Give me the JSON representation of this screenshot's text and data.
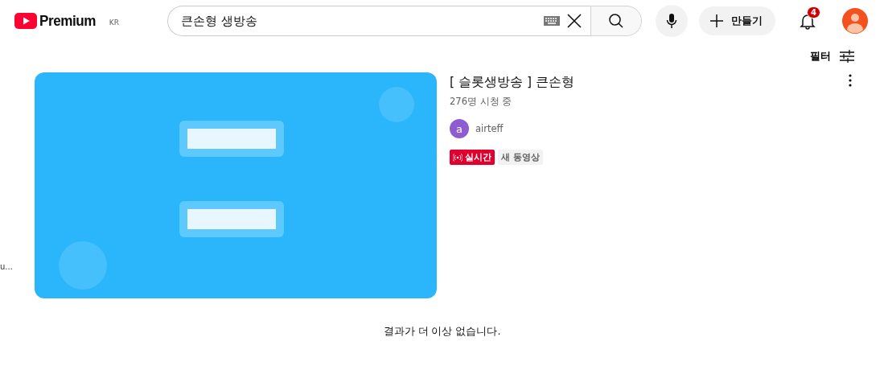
{
  "header": {
    "logo": {
      "text": "Premium",
      "region": "KR"
    },
    "search": {
      "value": "큰손형 생방송"
    },
    "create_button": "만들기",
    "notifications": {
      "count": "4"
    }
  },
  "filter": {
    "label": "필터"
  },
  "results": [
    {
      "title": "[ 슬롯생방송 ] 큰손형",
      "views": "276명 시청 중",
      "channel": {
        "initial": "a",
        "name": "airteff"
      },
      "badges": [
        {
          "kind": "live",
          "label": "실시간"
        },
        {
          "kind": "plain",
          "label": "새 동영상"
        }
      ]
    }
  ],
  "left_edge_text": "u...",
  "end_message": "결과가 더 이상 없습니다."
}
